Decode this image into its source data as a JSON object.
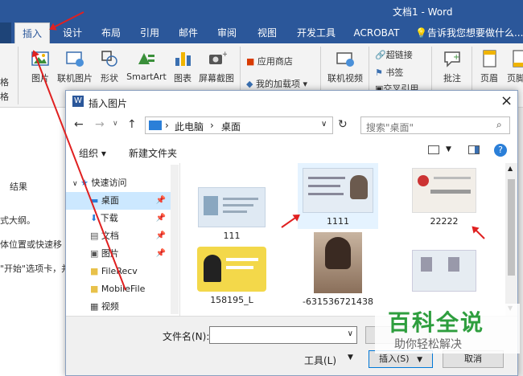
{
  "window": {
    "title": "文档1 - Word"
  },
  "tabs": [
    "插入",
    "设计",
    "布局",
    "引用",
    "邮件",
    "审阅",
    "视图",
    "开发工具",
    "ACROBAT",
    "告诉我您想要做什么..."
  ],
  "active_tab": "插入",
  "ribbon": {
    "partial_left_top": "格",
    "partial_left_bottom": "格",
    "picture": "图片",
    "online_picture": "联机图片",
    "shapes": "形状",
    "smartart": "SmartArt",
    "chart": "图表",
    "screenshot": "屏幕截图",
    "app_store": "应用商店",
    "my_addins": "我的加载项",
    "online_video": "联机视频",
    "hyperlink": "超链接",
    "bookmark": "书签",
    "cross_ref": "交叉引用",
    "comment": "批注",
    "header": "页眉",
    "footer": "页脚"
  },
  "document": {
    "result": "结果",
    "line1": "式大纲。",
    "line2": "体位置或快速移",
    "line3": "\"开始\"选项卡，并"
  },
  "dialog": {
    "title": "插入图片",
    "close": "×",
    "address": [
      "此电脑",
      "桌面"
    ],
    "search_placeholder": "搜索\"桌面\"",
    "organize": "组织 ▾",
    "new_folder": "新建文件夹",
    "nav": [
      {
        "label": "快速访问",
        "icon": "star-icon"
      },
      {
        "label": "桌面",
        "icon": "desktop-icon"
      },
      {
        "label": "下载",
        "icon": "download-icon"
      },
      {
        "label": "文档",
        "icon": "document-icon"
      },
      {
        "label": "图片",
        "icon": "pictures-icon"
      },
      {
        "label": "FileRecv",
        "icon": "folder-icon"
      },
      {
        "label": "MobileFile",
        "icon": "folder-icon"
      },
      {
        "label": "视频",
        "icon": "video-icon"
      }
    ],
    "files": [
      {
        "name": "111"
      },
      {
        "name": "1111"
      },
      {
        "name": "22222"
      },
      {
        "name": "158195_L"
      },
      {
        "name": "-631536721438"
      },
      {
        "name": ""
      }
    ],
    "filename_label": "文件名(N):",
    "filename_value": "",
    "tools": "工具(L)",
    "insert": "插入(S)",
    "cancel": "取消"
  },
  "watermark": {
    "title": "百科全说",
    "subtitle": "助你轻松解决"
  },
  "colors": {
    "ribbon_blue": "#2b579a",
    "arrow_red": "#e02020",
    "watermark_green": "#2e9e3e",
    "selection": "#cce8ff"
  }
}
